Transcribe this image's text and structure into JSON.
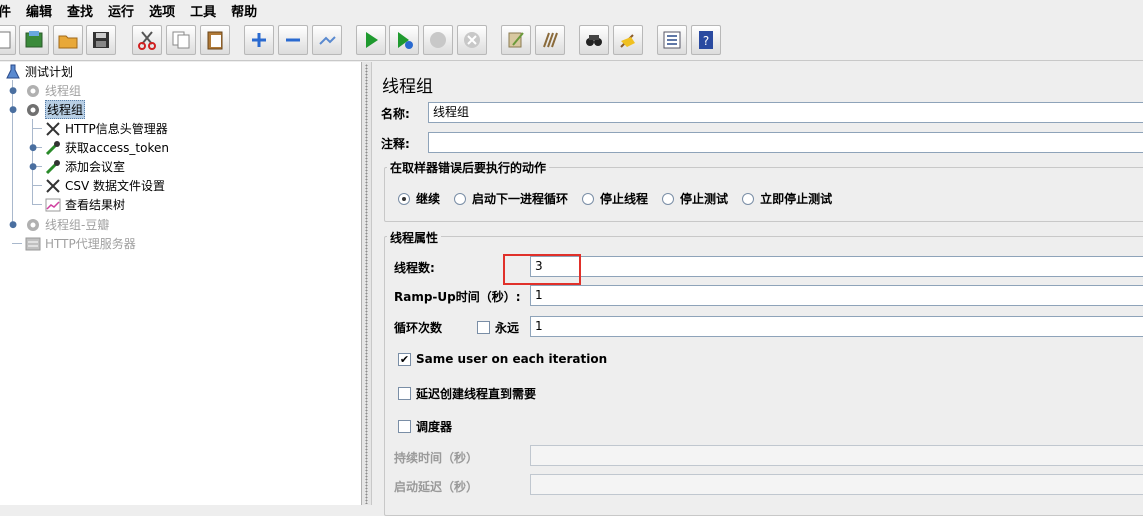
{
  "menu": [
    "件",
    "编辑",
    "查找",
    "运行",
    "选项",
    "工具",
    "帮助"
  ],
  "toolbar_icons": [
    "new-icon",
    "templates-icon",
    "open-icon",
    "save-icon",
    "cut-icon",
    "copy-icon",
    "paste-icon",
    "expand-icon",
    "collapse-icon",
    "toggle-icon",
    "start-icon",
    "start-no-timers-icon",
    "stop-icon",
    "shutdown-icon",
    "clear-icon",
    "clear-all-icon",
    "search-icon",
    "reset-search-icon",
    "function-helper-icon",
    "help-icon"
  ],
  "tree": {
    "root": "测试计划",
    "nodes": [
      {
        "label": "线程组",
        "disabled": true
      },
      {
        "label": "线程组",
        "selected": true
      },
      {
        "label": "HTTP信息头管理器"
      },
      {
        "label": "获取access_token"
      },
      {
        "label": "添加会议室"
      },
      {
        "label": "CSV 数据文件设置"
      },
      {
        "label": "查看结果树"
      },
      {
        "label": "线程组-豆瓣",
        "disabled": true
      },
      {
        "label": "HTTP代理服务器",
        "disabled": true
      }
    ]
  },
  "panel": {
    "title": "线程组",
    "name_label": "名称:",
    "name_value": "线程组",
    "comment_label": "注释:",
    "comment_value": "",
    "error_group_title": "在取样器错误后要执行的动作",
    "error_options": [
      "继续",
      "启动下一进程循环",
      "停止线程",
      "停止测试",
      "立即停止测试"
    ],
    "error_selected": 0,
    "thread_group_title": "线程属性",
    "threads_label": "线程数:",
    "threads_value": "3",
    "rampup_label": "Ramp-Up时间（秒）:",
    "rampup_value": "1",
    "loop_label": "循环次数",
    "forever_label": "永远",
    "loop_value": "1",
    "same_user_label": "Same user on each iteration",
    "same_user_checked": true,
    "delay_label": "延迟创建线程直到需要",
    "scheduler_label": "调度器",
    "duration_label": "持续时间（秒）",
    "duration_value": "",
    "startup_delay_label": "启动延迟（秒）",
    "startup_delay_value": ""
  },
  "colors": {
    "highlight": "#e0302a",
    "selection": "#b8cfe5"
  }
}
